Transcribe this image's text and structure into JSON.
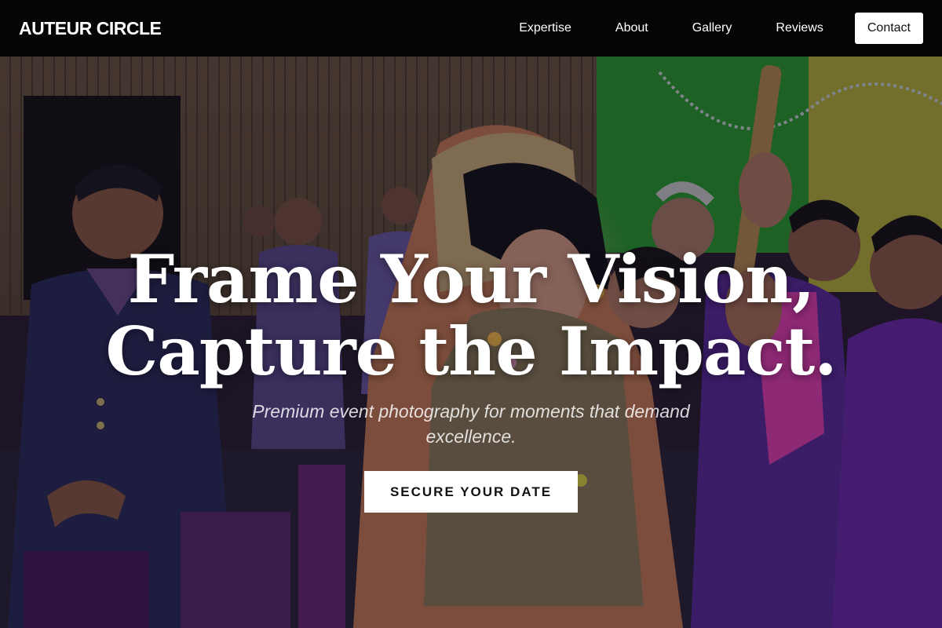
{
  "brand": {
    "name": "AUTEUR CIRCLE"
  },
  "nav": {
    "links": [
      "Expertise",
      "About",
      "Gallery",
      "Reviews"
    ],
    "contact_label": "Contact"
  },
  "hero": {
    "title_line1": "Frame Your Vision,",
    "title_line2": "Capture the Impact.",
    "subtitle": "Premium event photography for moments that demand excellence.",
    "cta_label": "SECURE YOUR DATE",
    "image_description": "wedding-celebration-photo"
  },
  "colors": {
    "navbar_bg": "#050505",
    "text_primary": "#ffffff",
    "button_bg": "#ffffff",
    "button_text": "#111111"
  }
}
